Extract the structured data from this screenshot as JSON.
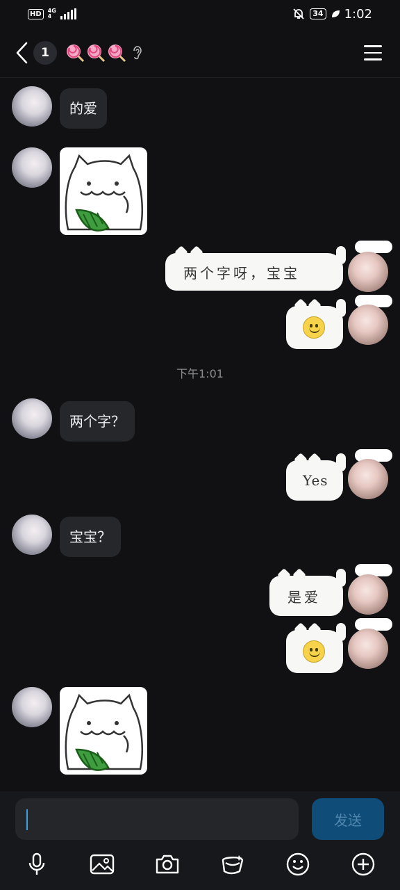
{
  "status_bar": {
    "hd": "HD",
    "network_top": "4G",
    "network_bottom": "4",
    "battery": "34",
    "time": "1:02"
  },
  "header": {
    "unread_count": "1",
    "title_icons": [
      "lollipop-icon",
      "lollipop-icon",
      "lollipop-icon",
      "ear-icon"
    ]
  },
  "messages": {
    "m1_text": "的爱",
    "m3_text": "两个字呀，宝宝",
    "timestamp": "下午1:01",
    "m5_text": "两个字？",
    "m6_text": "Yes",
    "m7_text": "宝宝？",
    "m8_text": "是爱"
  },
  "input": {
    "placeholder": "",
    "send_label": "发送"
  },
  "toolbar": [
    "mic-icon",
    "image-icon",
    "camera-icon",
    "gift-icon",
    "emoji-icon",
    "plus-icon"
  ],
  "colors": {
    "background": "#111114",
    "bubble_incoming": "#26272b",
    "send_button": "#0f4d78",
    "caret": "#3aa0e6"
  }
}
